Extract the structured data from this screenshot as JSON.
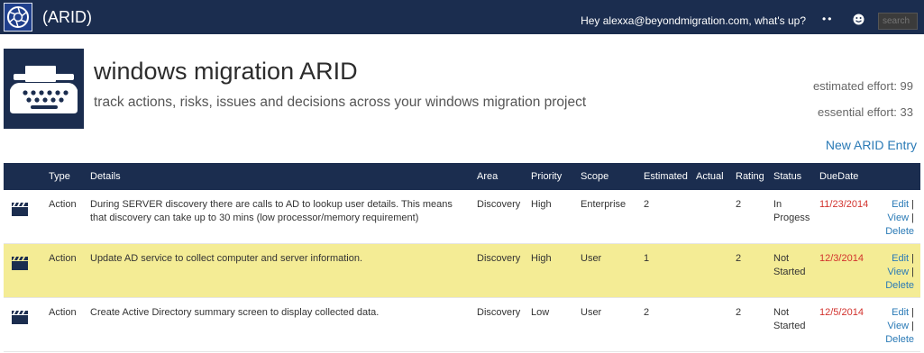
{
  "nav": {
    "title": "(ARID)",
    "greeting": "Hey alexxa@beyondmigration.com, what's up?",
    "dots": "••",
    "search_placeholder": "search"
  },
  "header": {
    "title": "windows migration ARID",
    "subtitle": "track actions, risks, issues and decisions across your windows migration project",
    "estimated_effort": "estimated effort: 99",
    "essential_effort": "essential effort: 33",
    "new_entry_label": "New ARID Entry"
  },
  "table": {
    "columns": {
      "type": "Type",
      "details": "Details",
      "area": "Area",
      "priority": "Priority",
      "scope": "Scope",
      "estimated": "Estimated",
      "actual": "Actual",
      "rating": "Rating",
      "status": "Status",
      "duedate": "DueDate"
    },
    "actions": {
      "edit": "Edit",
      "view": "View",
      "delete": "Delete",
      "sep": "|"
    },
    "rows": [
      {
        "type": "Action",
        "details": "During SERVER discovery there are calls to AD to lookup user details. This means that discovery can take up to 30 mins (low processor/memory requirement)",
        "area": "Discovery",
        "priority": "High",
        "scope": "Enterprise",
        "estimated": "2",
        "actual": "",
        "rating": "2",
        "status": "In Progess",
        "duedate": "11/23/2014"
      },
      {
        "type": "Action",
        "details": "Update AD service to collect computer and server information.",
        "area": "Discovery",
        "priority": "High",
        "scope": "User",
        "estimated": "1",
        "actual": "",
        "rating": "2",
        "status": "Not Started",
        "duedate": "12/3/2014"
      },
      {
        "type": "Action",
        "details": "Create Active Directory summary screen to display collected data.",
        "area": "Discovery",
        "priority": "Low",
        "scope": "User",
        "estimated": "2",
        "actual": "",
        "rating": "2",
        "status": "Not Started",
        "duedate": "12/5/2014"
      }
    ]
  },
  "colors": {
    "navbar": "#1b2d4f",
    "highlight_row": "#f4ec95",
    "link": "#2a7ab6",
    "due_date": "#d2322d"
  },
  "icons": {
    "logo": "aperture-logo-icon",
    "smiley": "smiley-icon",
    "hero": "typewriter-icon",
    "row": "clapperboard-icon"
  }
}
